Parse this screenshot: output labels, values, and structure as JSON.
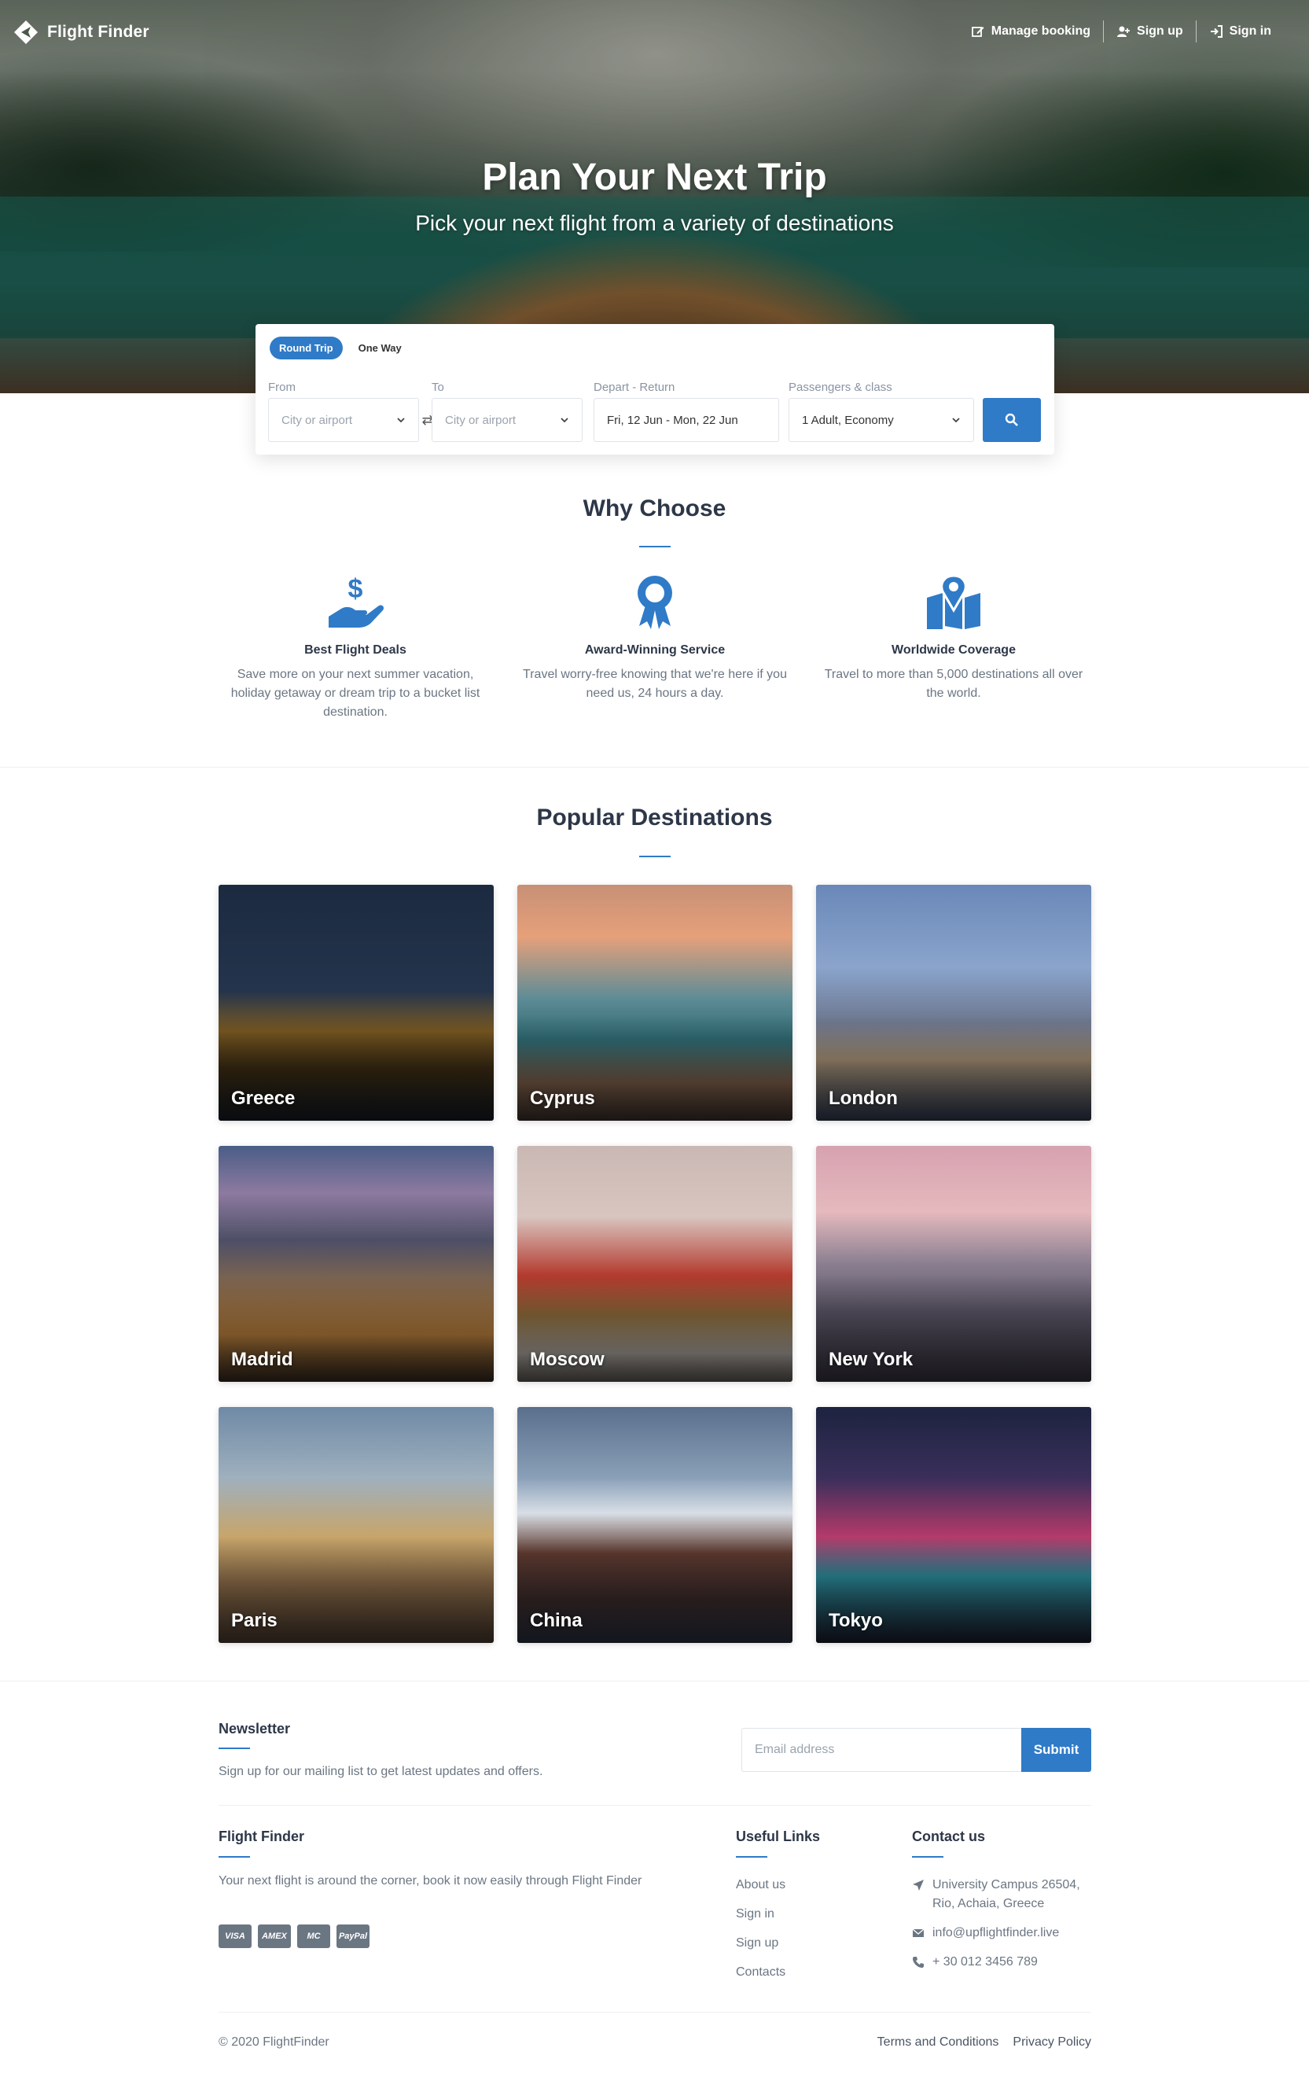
{
  "header": {
    "brand": "Flight Finder",
    "nav": {
      "manage_booking": "Manage booking",
      "sign_up": "Sign up",
      "sign_in": "Sign in"
    }
  },
  "hero": {
    "title": "Plan Your Next Trip",
    "subtitle": "Pick your next flight from a variety of destinations"
  },
  "search": {
    "tabs": [
      "Round Trip",
      "One Way"
    ],
    "active_tab": "Round Trip",
    "from": {
      "label": "From",
      "placeholder": "City or airport"
    },
    "to": {
      "label": "To",
      "placeholder": "City or airport"
    },
    "dates": {
      "label": "Depart - Return",
      "value": "Fri, 12 Jun - Mon, 22 Jun"
    },
    "passengers": {
      "label": "Passengers & class",
      "value": "1 Adult, Economy"
    }
  },
  "why": {
    "title": "Why Choose",
    "features": [
      {
        "icon": "hand-dollar-icon",
        "title": "Best Flight Deals",
        "desc": "Save more on your next summer vacation, holiday getaway or dream trip to a bucket list destination."
      },
      {
        "icon": "award-ribbon-icon",
        "title": "Award-Winning Service",
        "desc": "Travel worry-free knowing that we're here if you need us, 24 hours a day."
      },
      {
        "icon": "map-pin-icon",
        "title": "Worldwide Coverage",
        "desc": "Travel to more than 5,000 destinations all over the world."
      }
    ]
  },
  "destinations": {
    "title": "Popular Destinations",
    "items": [
      {
        "name": "Greece",
        "bg": "linear-gradient(180deg,#1b2a40 0%,#24344c 45%,#7a5a22 62%,#3a2a12 78%,#141a22 100%)"
      },
      {
        "name": "Cyprus",
        "bg": "linear-gradient(180deg,#c79076 0%,#e6a07a 22%,#5f8c96 48%,#2e6a72 66%,#7a5c48 84%,#3b2f2a 100%)"
      },
      {
        "name": "London",
        "bg": "linear-gradient(180deg,#6a88b8 0%,#8aa4cc 35%,#6e7890 58%,#a48f74 74%,#2e3a50 100%)"
      },
      {
        "name": "Madrid",
        "bg": "linear-gradient(180deg,#4a5d86 0%,#8d7aa0 20%,#4d4f66 40%,#8a6a4a 62%,#b27a3a 80%,#33281e 100%)"
      },
      {
        "name": "Moscow",
        "bg": "linear-gradient(180deg,#c9b8b3 0%,#d9c5c0 30%,#b33a2e 55%,#8a6a3a 72%,#a9a39d 88%,#5e5955 100%)"
      },
      {
        "name": "New York",
        "bg": "linear-gradient(180deg,#d6a2b0 0%,#e5b9bd 28%,#8a7f90 50%,#5a5566 70%,#36333e 100%)"
      },
      {
        "name": "Paris",
        "bg": "linear-gradient(180deg,#6f8aa6 0%,#9fb0be 30%,#c7a56a 55%,#8a6a48 75%,#4a3a2e 100%)"
      },
      {
        "name": "China",
        "bg": "linear-gradient(180deg,#5a6f8c 0%,#8aa0b8 30%,#d8dee6 45%,#5e3a30 62%,#3a2a2a 82%,#2a3140 100%)"
      },
      {
        "name": "Tokyo",
        "bg": "linear-gradient(180deg,#1d2340 0%,#3a2f5a 30%,#b43a6a 55%,#2a8a9a 72%,#1a1a2a 100%)"
      }
    ]
  },
  "newsletter": {
    "title": "Newsletter",
    "text": "Sign up for our mailing list to get latest updates and offers.",
    "placeholder": "Email address",
    "submit": "Submit"
  },
  "footer": {
    "about_title": "Flight Finder",
    "about_text": "Your next flight is around the corner, book it now easily through Flight Finder",
    "cards": [
      "VISA",
      "AMEX",
      "MC",
      "PayPal"
    ],
    "links_title": "Useful Links",
    "links": [
      "About us",
      "Sign in",
      "Sign up",
      "Contacts"
    ],
    "contact_title": "Contact us",
    "contact": {
      "address": "University Campus 26504, Rio, Achaia, Greece",
      "email": "info@upflightfinder.live",
      "phone": "+ 30 012 3456 789"
    },
    "copyright": "© 2020 FlightFinder",
    "terms": "Terms and Conditions",
    "privacy": "Privacy Policy"
  },
  "colors": {
    "accent": "#2f7bc8",
    "text": "#2d3748",
    "muted": "#6b7683"
  }
}
